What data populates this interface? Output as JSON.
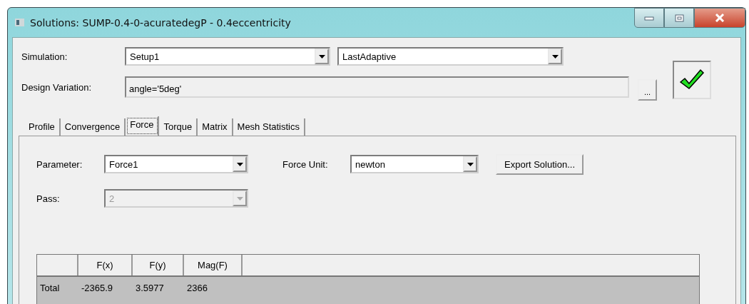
{
  "window": {
    "title": "Solutions: SUMP-0.4-0-acuratedegP - 0.4eccentricity"
  },
  "simulation": {
    "label": "Simulation:",
    "setup": "Setup1",
    "solution": "LastAdaptive"
  },
  "design_variation": {
    "label": "Design Variation:",
    "value": "angle='5deg'",
    "browse_button": "...",
    "valid": true
  },
  "tabs": [
    {
      "label": "Profile",
      "selected": false
    },
    {
      "label": "Convergence",
      "selected": false
    },
    {
      "label": "Force",
      "selected": true
    },
    {
      "label": "Torque",
      "selected": false
    },
    {
      "label": "Matrix",
      "selected": false
    },
    {
      "label": "Mesh Statistics",
      "selected": false
    }
  ],
  "parameter": {
    "label": "Parameter:",
    "value": "Force1"
  },
  "force_unit": {
    "label": "Force Unit:",
    "value": "newton"
  },
  "export_button": "Export Solution...",
  "pass": {
    "label": "Pass:",
    "value": "2",
    "disabled": true
  },
  "table": {
    "columns": [
      "",
      "F(x)",
      "F(y)",
      "Mag(F)"
    ],
    "rows": [
      {
        "cells": [
          "Total",
          "-2365.9",
          "3.5977",
          "2366"
        ],
        "selected": true
      }
    ]
  }
}
